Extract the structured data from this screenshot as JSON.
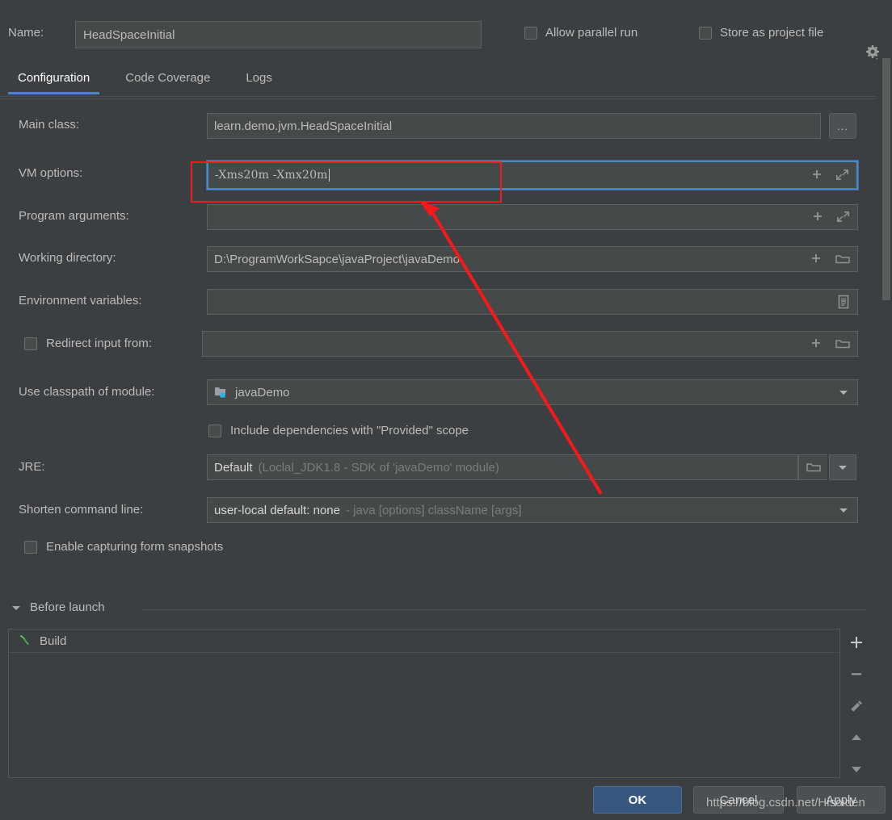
{
  "dialog": {
    "name_label": "Name:",
    "name_value": "HeadSpaceInitial",
    "allow_parallel_run": "Allow parallel run",
    "store_as_project_file": "Store as project file",
    "gear_icon": "gear-icon"
  },
  "tabs": [
    {
      "label": "Configuration",
      "active": true
    },
    {
      "label": "Code Coverage",
      "active": false
    },
    {
      "label": "Logs",
      "active": false
    }
  ],
  "form": {
    "main_class": {
      "label": "Main class:",
      "value": "learn.demo.jvm.HeadSpaceInitial",
      "browse_label": "..."
    },
    "vm_options": {
      "label": "VM options:",
      "value": "-Xms20m  -Xmx20m",
      "focused": true,
      "icons": [
        "plus-icon",
        "expand-icon"
      ]
    },
    "program_arguments": {
      "label": "Program arguments:",
      "value": "",
      "icons": [
        "plus-icon",
        "expand-icon"
      ]
    },
    "working_directory": {
      "label": "Working directory:",
      "value": "D:\\ProgramWorkSapce\\javaProject\\javaDemo",
      "icons": [
        "plus-icon",
        "folder-icon"
      ]
    },
    "environment_variables": {
      "label": "Environment variables:",
      "value": "",
      "icons": [
        "list-icon"
      ]
    },
    "redirect_input": {
      "label": "Redirect input from:",
      "value": "",
      "checked": false,
      "icons": [
        "plus-icon",
        "folder-icon"
      ]
    },
    "classpath_module": {
      "label": "Use classpath of module:",
      "value": "javaDemo",
      "icon": "module-folder-icon"
    },
    "include_provided": {
      "label": "Include dependencies with \"Provided\" scope",
      "checked": false
    },
    "jre": {
      "label": "JRE:",
      "value": "Default",
      "hint": "(Loclal_JDK1.8 - SDK of 'javaDemo' module)"
    },
    "shorten_command_line": {
      "label": "Shorten command line:",
      "value": "user-local default: none",
      "hint": "- java [options] className [args]"
    },
    "capture_snapshots": {
      "label": "Enable capturing form snapshots",
      "checked": false
    }
  },
  "before_launch": {
    "title": "Before launch",
    "collapse_icon": "triangle-down-icon",
    "items": [
      {
        "icon": "hammer-icon",
        "label": "Build"
      }
    ],
    "toolbar": [
      {
        "name": "add-button",
        "icon": "plus-icon"
      },
      {
        "name": "remove-button",
        "icon": "minus-icon"
      },
      {
        "name": "edit-button",
        "icon": "pencil-icon"
      },
      {
        "name": "move-up-button",
        "icon": "arrow-up-icon"
      },
      {
        "name": "move-down-button",
        "icon": "arrow-down-icon"
      }
    ]
  },
  "footer": {
    "ok": "OK",
    "cancel": "Cancel",
    "apply": "Apply"
  },
  "annotations": {
    "watermark": "https://blog.csdn.net/Hisoiden",
    "highlight_color": "#f71919"
  }
}
